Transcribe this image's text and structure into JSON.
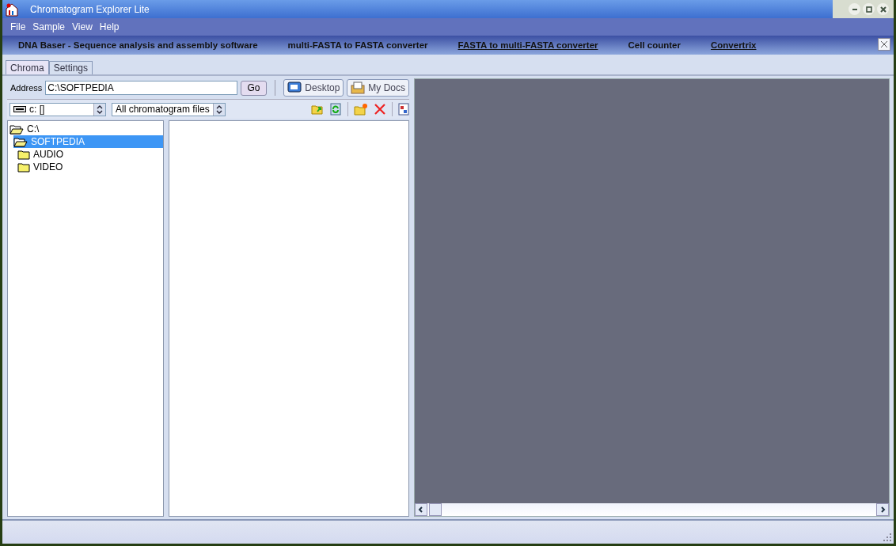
{
  "window": {
    "title": "Chromatogram Explorer Lite"
  },
  "menu": [
    {
      "label": "File"
    },
    {
      "label": "Sample"
    },
    {
      "label": "View"
    },
    {
      "label": "Help"
    }
  ],
  "links": [
    {
      "label": "DNA Baser - Sequence analysis and assembly software",
      "underlined": false
    },
    {
      "label": "multi-FASTA to FASTA converter",
      "underlined": false
    },
    {
      "label": "FASTA to multi-FASTA converter",
      "underlined": true
    },
    {
      "label": "Cell counter",
      "underlined": false
    },
    {
      "label": "Convertrix",
      "underlined": true
    }
  ],
  "tabs": [
    {
      "label": "Chroma",
      "selected": true
    },
    {
      "label": "Settings",
      "selected": false
    }
  ],
  "address": {
    "label": "Address",
    "value": "C:\\SOFTPEDIA",
    "go": "Go"
  },
  "places": [
    {
      "label": "Desktop",
      "kind": "desktop"
    },
    {
      "label": "My Docs",
      "kind": "docs"
    }
  ],
  "drive": {
    "value": "c: []"
  },
  "filter": {
    "value": "All chromatogram files"
  },
  "tree": [
    {
      "label": "C:\\",
      "selected": false,
      "expanded": true,
      "children": [
        {
          "label": "SOFTPEDIA",
          "selected": true,
          "expanded": true,
          "children": [
            {
              "label": "AUDIO",
              "selected": false,
              "expanded": false
            },
            {
              "label": "VIDEO",
              "selected": false,
              "expanded": false
            }
          ]
        }
      ]
    }
  ]
}
